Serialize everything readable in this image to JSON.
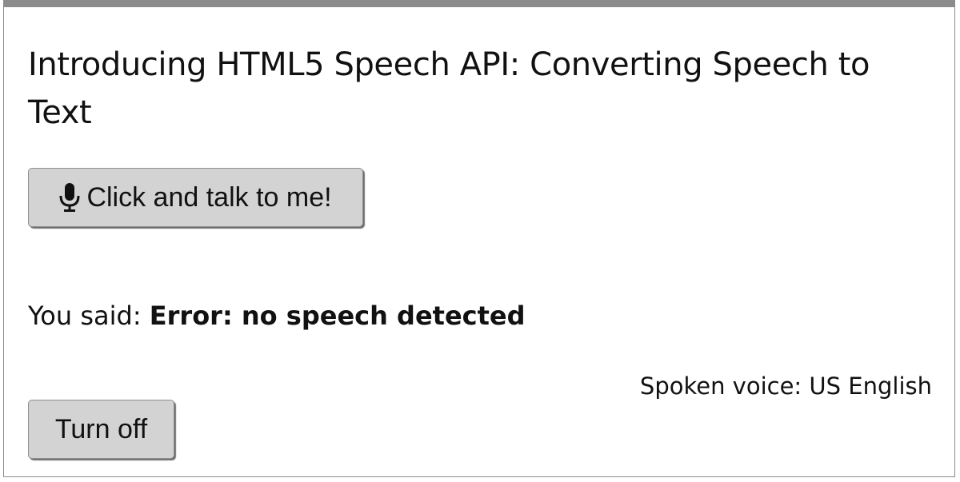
{
  "page": {
    "title": "Introducing HTML5 Speech API: Converting Speech to Text"
  },
  "talk_button": {
    "icon": "microphone-icon",
    "label": "Click and talk to me!"
  },
  "transcript": {
    "prefix": "You said:",
    "result": "Error: no speech detected"
  },
  "voice": {
    "text": "Spoken voice: US English"
  },
  "off_button": {
    "label": "Turn off"
  },
  "colors": {
    "button_bg": "#d3d3d3",
    "top_border": "#8c8c8c",
    "text": "#111111"
  }
}
